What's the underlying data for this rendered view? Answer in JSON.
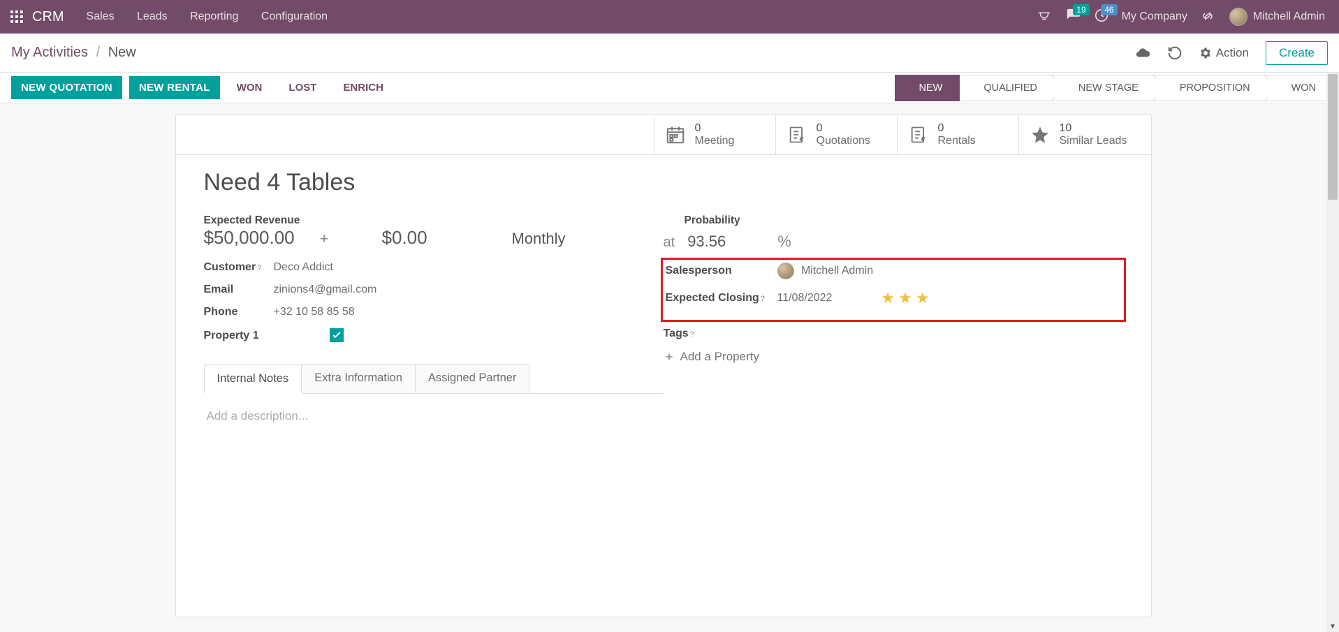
{
  "topbar": {
    "brand": "CRM",
    "menu": [
      "Sales",
      "Leads",
      "Reporting",
      "Configuration"
    ],
    "messages_badge": "19",
    "clock_badge": "46",
    "company": "My Company",
    "user_name": "Mitchell Admin"
  },
  "breadcrumb": {
    "parent": "My Activities",
    "current": "New",
    "action_label": "Action",
    "create_label": "Create"
  },
  "buttons": {
    "new_quotation": "NEW QUOTATION",
    "new_rental": "NEW RENTAL",
    "won": "WON",
    "lost": "LOST",
    "enrich": "ENRICH"
  },
  "stages": [
    {
      "label": "NEW",
      "active": true
    },
    {
      "label": "QUALIFIED",
      "active": false
    },
    {
      "label": "NEW STAGE",
      "active": false
    },
    {
      "label": "PROPOSITION",
      "active": false
    },
    {
      "label": "WON",
      "active": false
    }
  ],
  "stats": {
    "meeting": {
      "count": "0",
      "label": "Meeting"
    },
    "quotations": {
      "count": "0",
      "label": "Quotations"
    },
    "rentals": {
      "count": "0",
      "label": "Rentals"
    },
    "similar": {
      "count": "10",
      "label": "Similar Leads"
    }
  },
  "record": {
    "title": "Need 4 Tables",
    "expected_revenue_label": "Expected Revenue",
    "expected_revenue": "$50,000.00",
    "recurring_revenue": "$0.00",
    "recurring_period": "Monthly",
    "customer_label": "Customer",
    "customer": "Deco Addict",
    "email_label": "Email",
    "email": "zinions4@gmail.com",
    "phone_label": "Phone",
    "phone": "+32 10 58 85 58",
    "property1_label": "Property 1",
    "probability_label": "Probability",
    "probability_at": "at",
    "probability_value": "93.56",
    "probability_pct": "%",
    "salesperson_label": "Salesperson",
    "salesperson": "Mitchell Admin",
    "expected_closing_label": "Expected Closing",
    "expected_closing": "11/08/2022",
    "priority_stars": 3,
    "tags_label": "Tags",
    "add_property_label": "Add a Property"
  },
  "tabs": {
    "internal_notes": "Internal Notes",
    "extra_info": "Extra Information",
    "assigned_partner": "Assigned Partner"
  },
  "description_placeholder": "Add a description..."
}
